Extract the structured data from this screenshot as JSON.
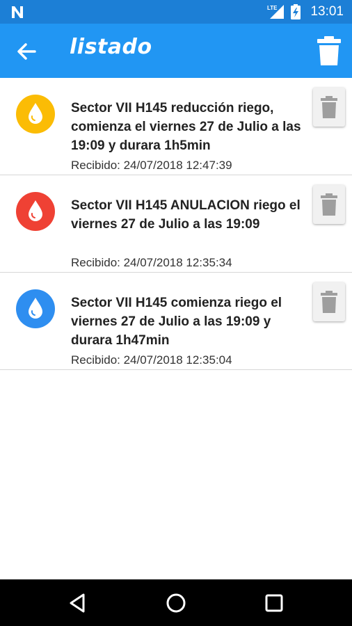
{
  "status_bar": {
    "network_label": "LTE",
    "time": "13:01",
    "icons": [
      "n-notification-icon",
      "signal-icon",
      "battery-charging-icon"
    ]
  },
  "app_bar": {
    "title": "listado",
    "icons": [
      "back-arrow-icon",
      "trash-icon"
    ]
  },
  "notifications": [
    {
      "text": "Sector VII H145 reducción riego, comienza el viernes 27 de Julio a las 19:09 y durara 1h5min",
      "received": "Recibido: 24/07/2018 12:47:39",
      "icon": "water-drop-icon",
      "color": "#fbbc05"
    },
    {
      "text": "Sector VII H145 ANULACION riego el viernes 27 de Julio a las 19:09",
      "received": "Recibido: 24/07/2018 12:35:34",
      "icon": "water-drop-icon",
      "color": "#ef4134"
    },
    {
      "text": "Sector VII H145 comienza riego el viernes 27 de Julio a las 19:09 y durara 1h47min",
      "received": "Recibido: 24/07/2018 12:35:04",
      "icon": "water-drop-icon",
      "color": "#2e8ef0"
    }
  ],
  "nav_bar": {
    "icons": [
      "back-triangle-icon",
      "home-circle-icon",
      "recents-square-icon"
    ]
  },
  "colors": {
    "status_bar": "#1c7fd6",
    "app_bar": "#2196f3",
    "delete_icon": "#9e9e9e"
  }
}
